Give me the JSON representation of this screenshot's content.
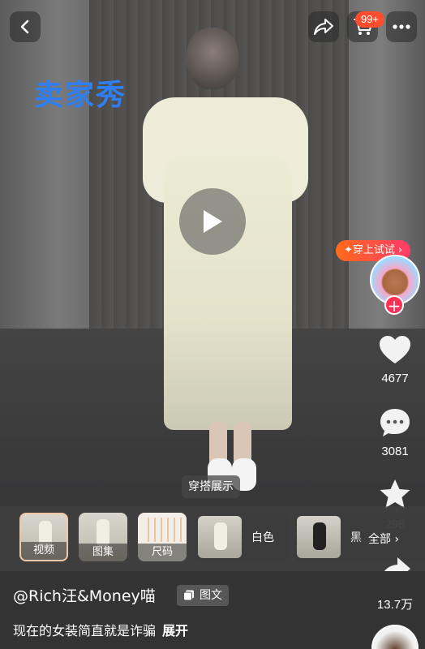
{
  "header": {
    "cart_badge": "99+"
  },
  "overlay": {
    "seller_show": "卖家秀",
    "outfit_tag": "穿搭展示"
  },
  "rail": {
    "try_on": "✦穿上试试",
    "likes": "4677",
    "comments": "3081",
    "favorites": "298",
    "shares": "13.7万"
  },
  "strip": {
    "tabs": [
      {
        "label": "视频",
        "selected": true
      },
      {
        "label": "图集",
        "selected": false
      },
      {
        "label": "尺码",
        "selected": false
      }
    ],
    "colors": [
      {
        "name": "白色"
      },
      {
        "name": "黑"
      }
    ],
    "view_all": "全部 ›"
  },
  "post": {
    "author": "@Rich汪&Money喵",
    "type_label": "图文",
    "caption": "现在的女装简直就是诈骗",
    "expand": "展开"
  },
  "colors": {
    "accent": "#ff4d2e",
    "seller_show": "#2f7ff2",
    "follow": "#ff2f55"
  }
}
